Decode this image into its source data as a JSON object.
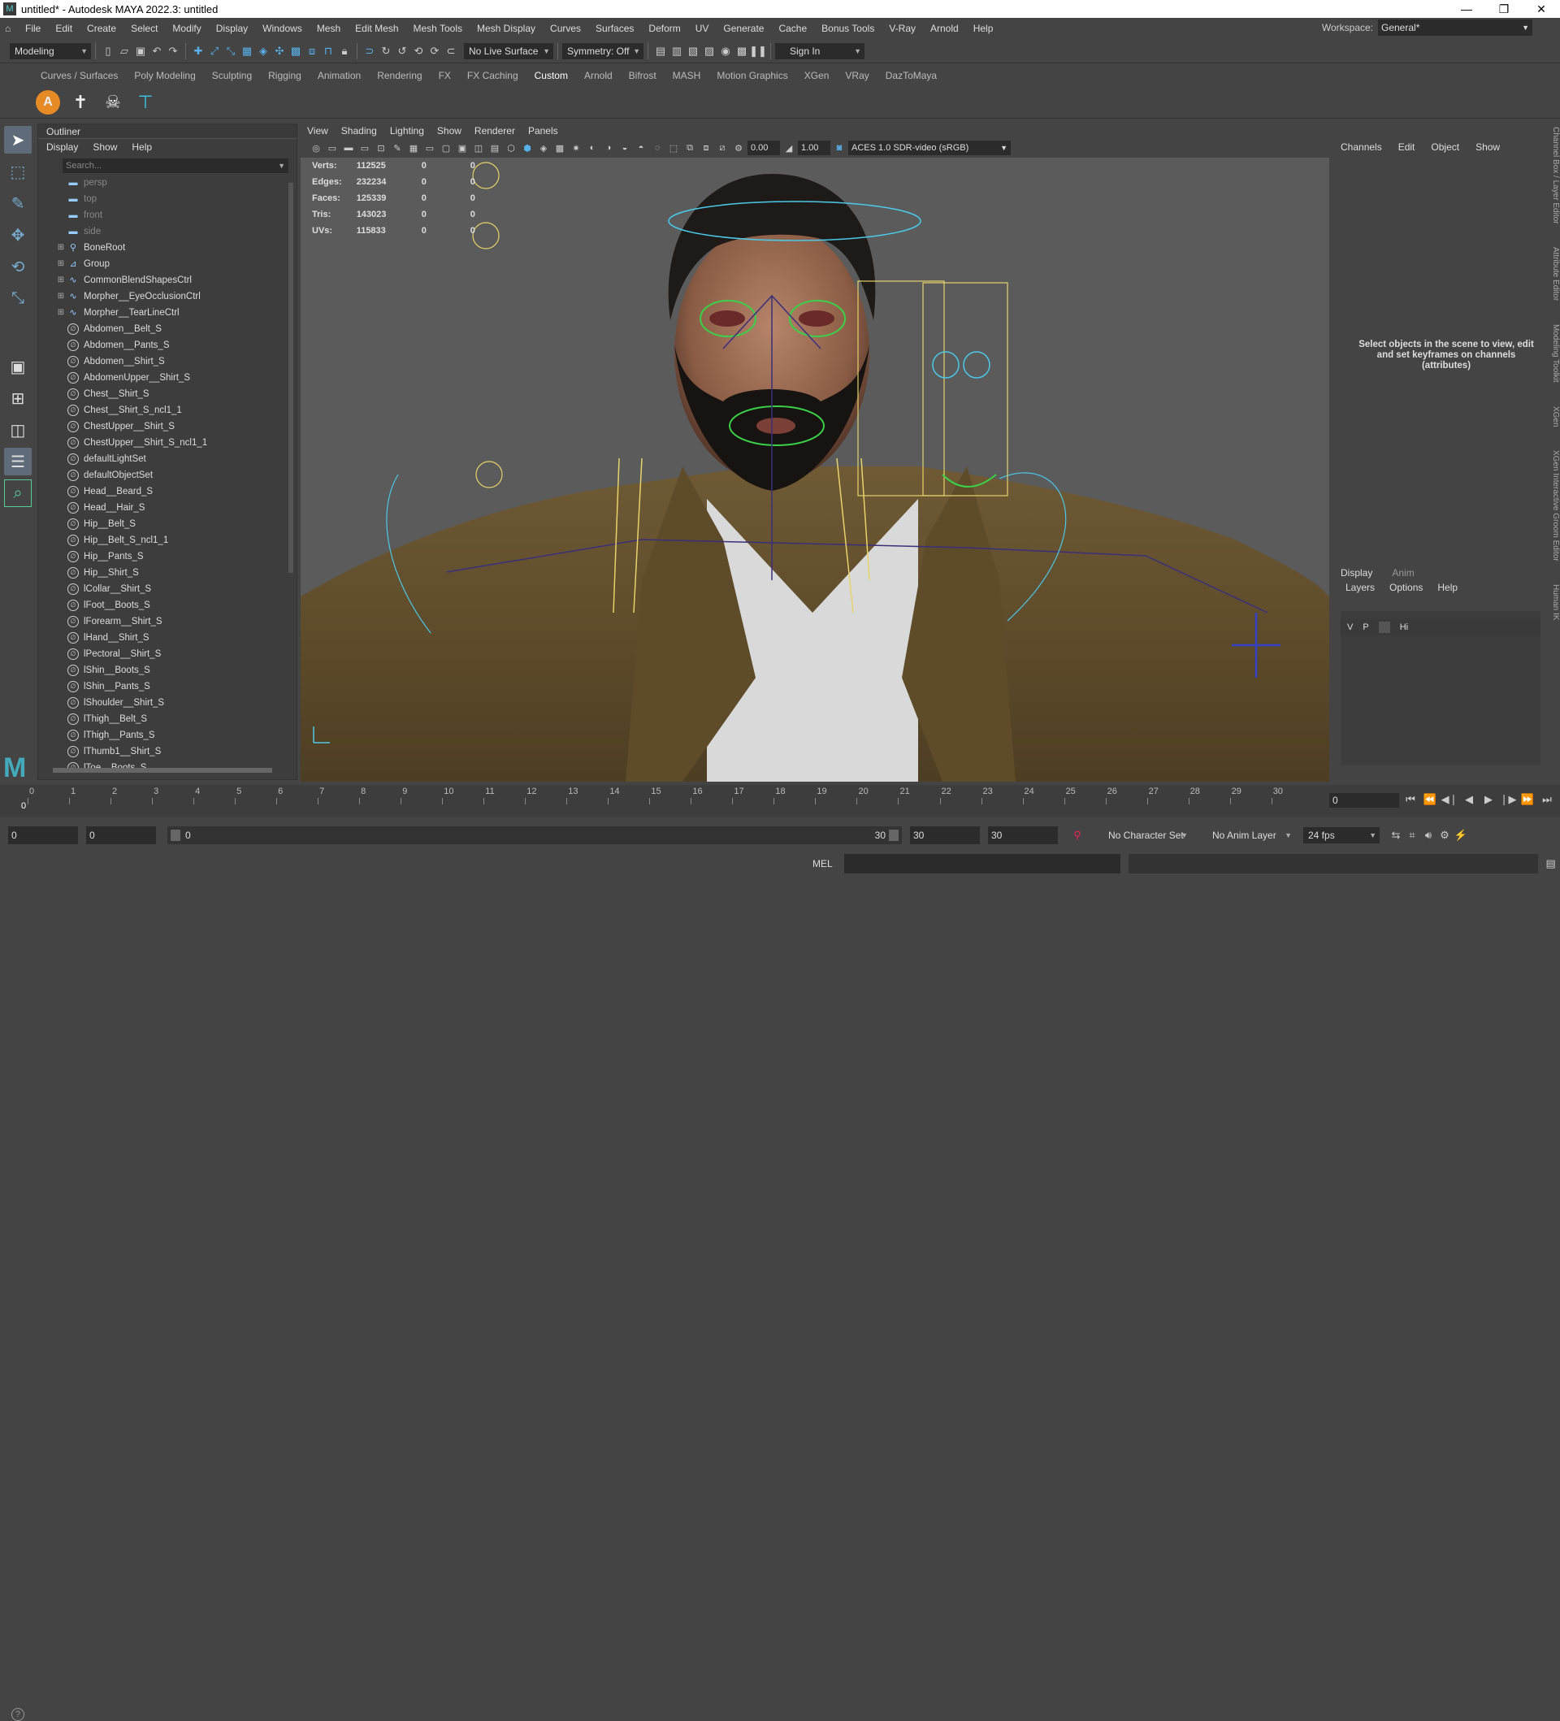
{
  "window": {
    "title": "untitled* - Autodesk MAYA 2022.3: untitled",
    "minimize": "—",
    "maximize": "❐",
    "close": "✕"
  },
  "menu": [
    "File",
    "Edit",
    "Create",
    "Select",
    "Modify",
    "Display",
    "Windows",
    "Mesh",
    "Edit Mesh",
    "Mesh Tools",
    "Mesh Display",
    "Curves",
    "Surfaces",
    "Deform",
    "UV",
    "Generate",
    "Cache",
    "Bonus Tools",
    "V-Ray",
    "Arnold",
    "Help"
  ],
  "workspace": {
    "label": "Workspace:",
    "value": "General*"
  },
  "status": {
    "mode": "Modeling",
    "live_surface": "No Live Surface",
    "symmetry": "Symmetry: Off",
    "sign_in": "Sign In"
  },
  "shelf_tabs": [
    "Curves / Surfaces",
    "Poly Modeling",
    "Sculpting",
    "Rigging",
    "Animation",
    "Rendering",
    "FX",
    "FX Caching",
    "Custom",
    "Arnold",
    "Bifrost",
    "MASH",
    "Motion Graphics",
    "XGen",
    "VRay",
    "DazToMaya"
  ],
  "active_shelf_tab": "Custom",
  "outliner": {
    "title": "Outliner",
    "menu": [
      "Display",
      "Show",
      "Help"
    ],
    "search_placeholder": "Search...",
    "items": [
      {
        "label": "persp",
        "type": "camera",
        "dim": true
      },
      {
        "label": "top",
        "type": "camera",
        "dim": true
      },
      {
        "label": "front",
        "type": "camera",
        "dim": true
      },
      {
        "label": "side",
        "type": "camera",
        "dim": true
      },
      {
        "label": "BoneRoot",
        "type": "joint",
        "expand": true
      },
      {
        "label": "Group",
        "type": "group",
        "expand": true
      },
      {
        "label": "CommonBlendShapesCtrl",
        "type": "curve",
        "expand": true
      },
      {
        "label": "Morpher__EyeOcclusionCtrl",
        "type": "curve",
        "expand": true
      },
      {
        "label": "Morpher__TearLineCtrl",
        "type": "curve",
        "expand": true
      },
      {
        "label": "Abdomen__Belt_S",
        "type": "set"
      },
      {
        "label": "Abdomen__Pants_S",
        "type": "set"
      },
      {
        "label": "Abdomen__Shirt_S",
        "type": "set"
      },
      {
        "label": "AbdomenUpper__Shirt_S",
        "type": "set"
      },
      {
        "label": "Chest__Shirt_S",
        "type": "set"
      },
      {
        "label": "Chest__Shirt_S_ncl1_1",
        "type": "set"
      },
      {
        "label": "ChestUpper__Shirt_S",
        "type": "set"
      },
      {
        "label": "ChestUpper__Shirt_S_ncl1_1",
        "type": "set"
      },
      {
        "label": "defaultLightSet",
        "type": "set"
      },
      {
        "label": "defaultObjectSet",
        "type": "set"
      },
      {
        "label": "Head__Beard_S",
        "type": "set"
      },
      {
        "label": "Head__Hair_S",
        "type": "set"
      },
      {
        "label": "Hip__Belt_S",
        "type": "set"
      },
      {
        "label": "Hip__Belt_S_ncl1_1",
        "type": "set"
      },
      {
        "label": "Hip__Pants_S",
        "type": "set"
      },
      {
        "label": "Hip__Shirt_S",
        "type": "set"
      },
      {
        "label": "lCollar__Shirt_S",
        "type": "set"
      },
      {
        "label": "lFoot__Boots_S",
        "type": "set"
      },
      {
        "label": "lForearm__Shirt_S",
        "type": "set"
      },
      {
        "label": "lHand__Shirt_S",
        "type": "set"
      },
      {
        "label": "lPectoral__Shirt_S",
        "type": "set"
      },
      {
        "label": "lShin__Boots_S",
        "type": "set"
      },
      {
        "label": "lShin__Pants_S",
        "type": "set"
      },
      {
        "label": "lShoulder__Shirt_S",
        "type": "set"
      },
      {
        "label": "lThigh__Belt_S",
        "type": "set"
      },
      {
        "label": "lThigh__Pants_S",
        "type": "set"
      },
      {
        "label": "lThumb1__Shirt_S",
        "type": "set"
      },
      {
        "label": "lToe__Boots_S",
        "type": "set"
      }
    ]
  },
  "viewport": {
    "menu": [
      "View",
      "Shading",
      "Lighting",
      "Show",
      "Renderer",
      "Panels"
    ],
    "exposure": "0.00",
    "gamma": "1.00",
    "color_space": "ACES 1.0 SDR-video (sRGB)",
    "hud": [
      {
        "label": "Verts:",
        "a": "112525",
        "b": "0",
        "c": "0"
      },
      {
        "label": "Edges:",
        "a": "232234",
        "b": "0",
        "c": "0"
      },
      {
        "label": "Faces:",
        "a": "125339",
        "b": "0",
        "c": "0"
      },
      {
        "label": "Tris:",
        "a": "143023",
        "b": "0",
        "c": "0"
      },
      {
        "label": "UVs:",
        "a": "115833",
        "b": "0",
        "c": "0"
      }
    ]
  },
  "channel_box": {
    "menu": [
      "Channels",
      "Edit",
      "Object",
      "Show"
    ],
    "hint": "Select objects in the scene to view, edit and set keyframes on channels (attributes)",
    "tabs": [
      "Display",
      "Anim"
    ],
    "layer_menu": [
      "Layers",
      "Options",
      "Help"
    ],
    "layer": {
      "v": "V",
      "p": "P",
      "name": "Hi"
    }
  },
  "side_tabs": [
    "Channel Box / Layer Editor",
    "Attribute Editor",
    "Modeling Toolkit",
    "XGen",
    "XGen Interactive Groom Editor",
    "Human IK"
  ],
  "timeline": {
    "ticks": [
      "0",
      "1",
      "2",
      "3",
      "4",
      "5",
      "6",
      "7",
      "8",
      "9",
      "10",
      "11",
      "12",
      "13",
      "14",
      "15",
      "16",
      "17",
      "18",
      "19",
      "20",
      "21",
      "22",
      "23",
      "24",
      "25",
      "26",
      "27",
      "28",
      "29",
      "30"
    ],
    "current": "0",
    "current_field": "0"
  },
  "range": {
    "start": "0",
    "playback_start": "0",
    "slider_start": "0",
    "slider_end": "30",
    "playback_end": "30",
    "end": "30",
    "character_set": "No Character Set",
    "anim_layer": "No Anim Layer",
    "fps": "24 fps"
  },
  "command": {
    "lang": "MEL"
  }
}
